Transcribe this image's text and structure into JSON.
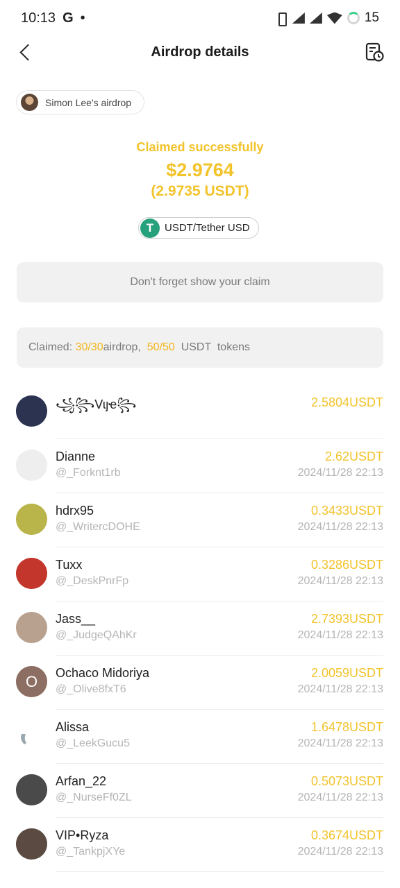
{
  "status_bar": {
    "time": "10:13",
    "g_icon": "G",
    "dot": "•",
    "battery": "15"
  },
  "header": {
    "title": "Airdrop details"
  },
  "sender": {
    "label": "Simon Lee's airdrop"
  },
  "claim": {
    "status": "Claimed successfully",
    "amount": "$2.9764",
    "usdt": "(2.9735 USDT)"
  },
  "token": {
    "icon_letter": "T",
    "label": "USDT/Tether USD"
  },
  "reminder": {
    "label": "Don't forget show your claim"
  },
  "claimed_summary": {
    "prefix": "Claimed: ",
    "airdrop_count": "30/30",
    "airdrop_label": "airdrop,  ",
    "token_count": "50/50",
    "token_label": "  USDT  tokens"
  },
  "claims": [
    {
      "name": "꧁꧂Vɩȷҽ꧂",
      "handle": "",
      "amount": "2.5804USDT",
      "time": "",
      "avatar_color": "#2b3350"
    },
    {
      "name": "Dianne",
      "handle": "@_Forknt1rb",
      "amount": "2.62USDT",
      "time": "2024/11/28 22:13",
      "avatar_color": "#eeeeee"
    },
    {
      "name": "hdrx95",
      "handle": "@_WritercDOHE",
      "amount": "0.3433USDT",
      "time": "2024/11/28 22:13",
      "avatar_color": "#b9b54a"
    },
    {
      "name": "Tuxx",
      "handle": "@_DeskPnrFp",
      "amount": "0.3286USDT",
      "time": "2024/11/28 22:13",
      "avatar_color": "#c2362b"
    },
    {
      "name": "Jass__",
      "handle": "@_JudgeQAhKr",
      "amount": "2.7393USDT",
      "time": "2024/11/28 22:13",
      "avatar_color": "#b9a18f"
    },
    {
      "name": "Ochaco Midoriya",
      "handle": "@_Olive8fxT6",
      "amount": "2.0059USDT",
      "time": "2024/11/28 22:13",
      "avatar_color": "#8d6e63",
      "initial": "O"
    },
    {
      "name": "Alissa",
      "handle": "@_LeekGucu5",
      "amount": "1.6478USDT",
      "time": "2024/11/28 22:13",
      "avatar_color": "#ffffff"
    },
    {
      "name": "Arfan_22",
      "handle": "@_NurseFf0ZL",
      "amount": "0.5073USDT",
      "time": "2024/11/28 22:13",
      "avatar_color": "#4a4a4a"
    },
    {
      "name": "VIP•Ryza",
      "handle": "@_TankpjXYe",
      "amount": "0.3674USDT",
      "time": "2024/11/28 22:13",
      "avatar_color": "#5b4a42"
    }
  ],
  "colors": {
    "accent": "#f2c32b",
    "tether": "#26a17b",
    "muted": "#b5b5b5"
  }
}
